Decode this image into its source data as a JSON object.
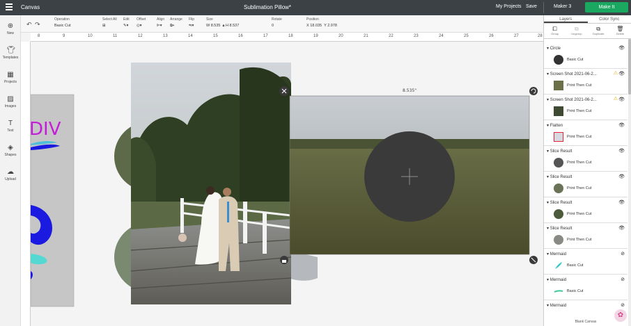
{
  "topbar": {
    "app_name": "Canvas",
    "document_title": "Sublimation Pillow*",
    "my_projects": "My Projects",
    "save": "Save",
    "machine": "Maker 3",
    "make_it": "Make It"
  },
  "toolbar": {
    "operation_label": "Operation",
    "operation_value": "Basic Cut",
    "select_all": "Select All",
    "edit": "Edit",
    "offset": "Offset",
    "align": "Align",
    "arrange": "Arrange",
    "flip": "Flip",
    "size_label": "Size",
    "width": "W 8.535",
    "height": "H 8.537",
    "rotate_label": "Rotate",
    "rotate_value": "0",
    "position_label": "Position",
    "x_value": "X 18.035",
    "y_value": "Y 2.978"
  },
  "ruler": [
    "8",
    "9",
    "10",
    "11",
    "12",
    "13",
    "14",
    "15",
    "16",
    "17",
    "18",
    "19",
    "20",
    "21",
    "22",
    "23",
    "24",
    "25",
    "26",
    "27",
    "28"
  ],
  "leftbar": {
    "items": [
      {
        "label": "New",
        "icon": "plus-circle-icon"
      },
      {
        "label": "Templates",
        "icon": "shirt-icon"
      },
      {
        "label": "Projects",
        "icon": "projects-icon"
      },
      {
        "label": "Images",
        "icon": "image-icon"
      },
      {
        "label": "Text",
        "icon": "text-icon"
      },
      {
        "label": "Shapes",
        "icon": "shapes-icon"
      },
      {
        "label": "Upload",
        "icon": "upload-icon"
      }
    ]
  },
  "canvas": {
    "dimension_label": "8.535\"",
    "sidebar_text": "DIV"
  },
  "panel": {
    "tabs": [
      "Layers",
      "Color Sync"
    ],
    "actions": [
      "Group",
      "Ungroup",
      "Duplicate",
      "Delete"
    ],
    "layers": [
      {
        "name": "Circle",
        "operation": "Basic Cut",
        "warn": false
      },
      {
        "name": "Screen Shot 2021-06-2...",
        "operation": "Print Then Cut",
        "warn": true
      },
      {
        "name": "Screen Shot 2021-06-2...",
        "operation": "Print Then Cut",
        "warn": true
      },
      {
        "name": "Flatten",
        "operation": "Print Then Cut",
        "warn": false
      },
      {
        "name": "Slice Result",
        "operation": "Print Then Cut",
        "warn": false
      },
      {
        "name": "Slice Result",
        "operation": "Print Then Cut",
        "warn": false
      },
      {
        "name": "Slice Result",
        "operation": "Print Then Cut",
        "warn": false
      },
      {
        "name": "Slice Result",
        "operation": "Print Then Cut",
        "warn": false
      },
      {
        "name": "Mermaid",
        "operation": "Basic Cut",
        "warn": false
      },
      {
        "name": "Mermaid",
        "operation": "Basic Cut",
        "warn": false
      },
      {
        "name": "Mermaid",
        "operation": "",
        "warn": false
      }
    ],
    "footer": "Blank Canvas"
  }
}
